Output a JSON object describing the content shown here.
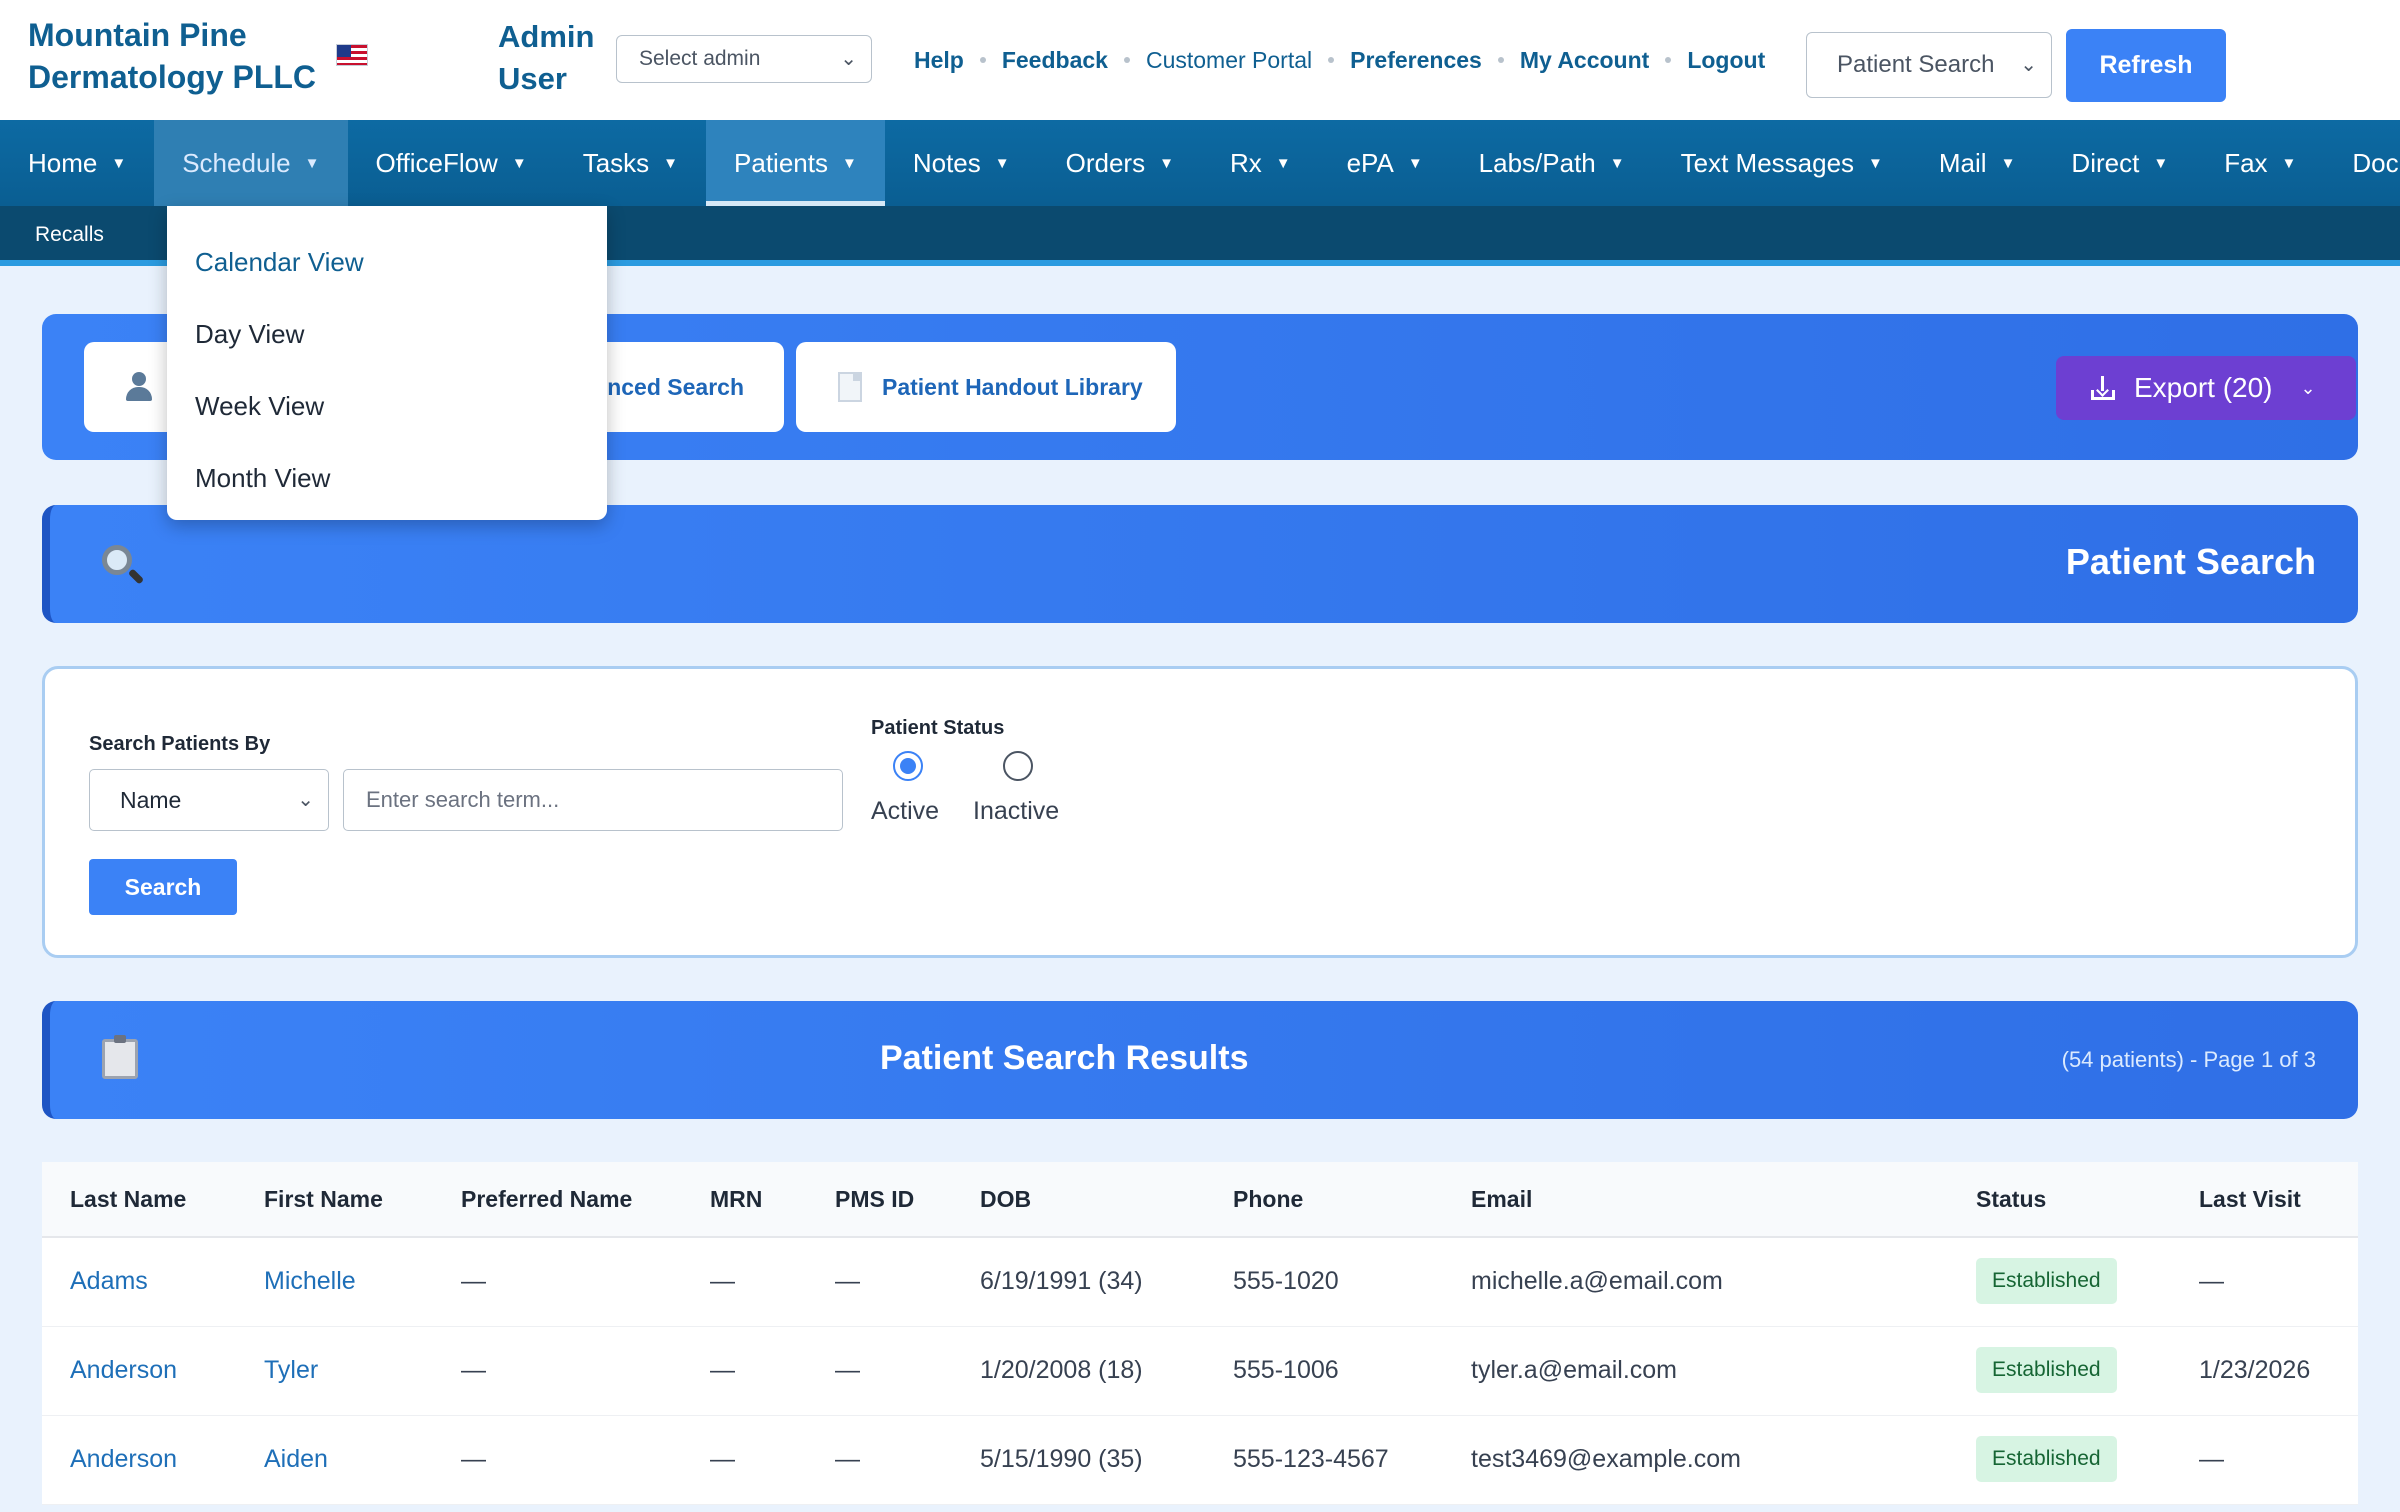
{
  "header": {
    "brand": "Mountain Pine Dermatology PLLC",
    "user": "Admin User",
    "admin_select": "Select admin",
    "links": [
      "Help",
      "Feedback",
      "Customer Portal",
      "Preferences",
      "My Account",
      "Logout"
    ],
    "patient_search_select": "Patient Search",
    "refresh_label": "Refresh"
  },
  "nav": {
    "items": [
      "Home",
      "Schedule",
      "OfficeFlow",
      "Tasks",
      "Patients",
      "Notes",
      "Orders",
      "Rx",
      "ePA",
      "Labs/Path",
      "Text Messages",
      "Mail",
      "Direct",
      "Fax",
      "Doc"
    ],
    "open_item": "Schedule",
    "active_item": "Patients"
  },
  "subnav": {
    "item": "Recalls"
  },
  "dropdown": {
    "items": [
      "Calendar View",
      "Day View",
      "Week View",
      "Month View"
    ]
  },
  "actions": {
    "advanced_search_fragment": "nced Search",
    "handout_library": "Patient Handout Library",
    "export_label": "Export (20)"
  },
  "patient_search": {
    "title": "Patient Search",
    "search_by_label": "Search Patients By",
    "search_by_value": "Name",
    "search_placeholder": "Enter search term...",
    "status_label": "Patient Status",
    "status_active": "Active",
    "status_inactive": "Inactive",
    "search_button": "Search"
  },
  "results": {
    "title": "Patient Search Results",
    "meta": "(54 patients) - Page 1 of 3",
    "columns": [
      "Last Name",
      "First Name",
      "Preferred Name",
      "MRN",
      "PMS ID",
      "DOB",
      "Phone",
      "Email",
      "Status",
      "Last Visit"
    ],
    "rows": [
      {
        "last": "Adams",
        "first": "Michelle",
        "preferred": "—",
        "mrn": "—",
        "pms": "—",
        "dob": "6/19/1991 (34)",
        "phone": "555-1020",
        "email": "michelle.a@email.com",
        "status": "Established",
        "last_visit": "—"
      },
      {
        "last": "Anderson",
        "first": "Tyler",
        "preferred": "—",
        "mrn": "—",
        "pms": "—",
        "dob": "1/20/2008 (18)",
        "phone": "555-1006",
        "email": "tyler.a@email.com",
        "status": "Established",
        "last_visit": "1/23/2026"
      },
      {
        "last": "Anderson",
        "first": "Aiden",
        "preferred": "—",
        "mrn": "—",
        "pms": "—",
        "dob": "5/15/1990 (35)",
        "phone": "555-123-4567",
        "email": "test3469@example.com",
        "status": "Established",
        "last_visit": "—"
      }
    ]
  },
  "colors": {
    "brand": "#0f5f91",
    "nav": "#0d6aa3",
    "accent": "#3b82f6",
    "export": "#6d3fd2",
    "badge": "#d7f4e3"
  }
}
